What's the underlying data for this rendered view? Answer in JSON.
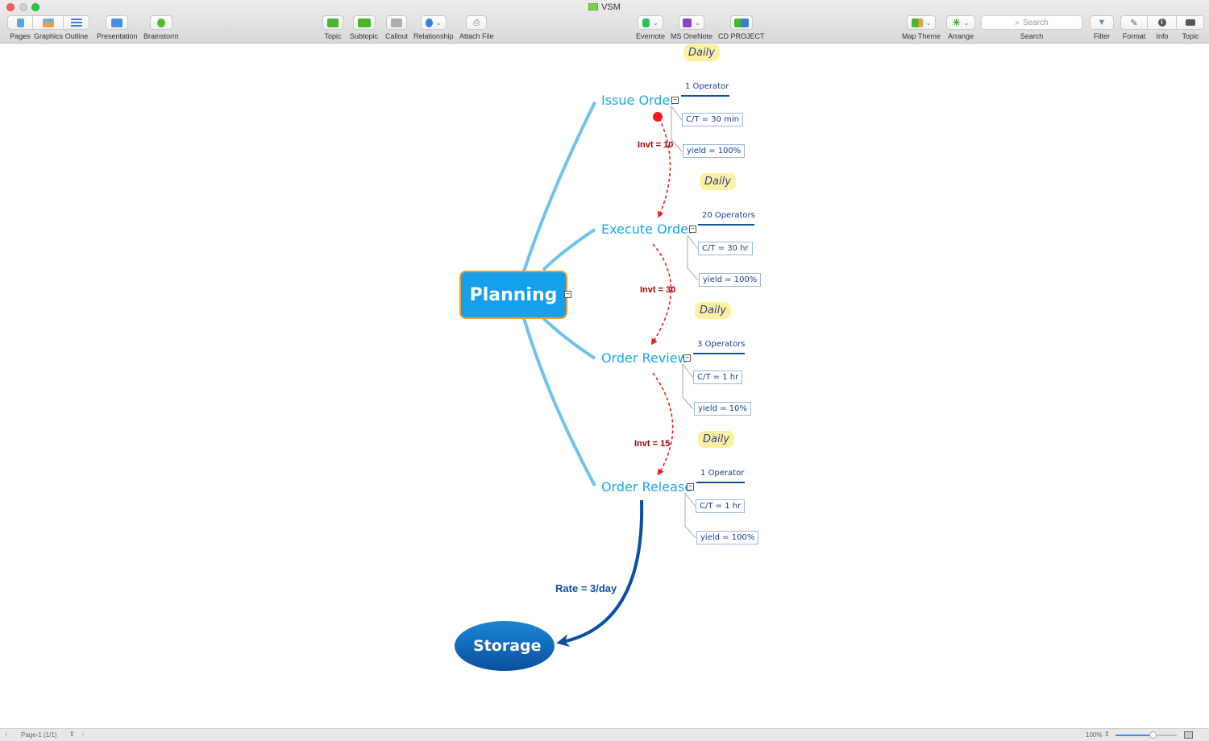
{
  "window": {
    "title": "VSM"
  },
  "toolbar": {
    "left": [
      {
        "id": "pages",
        "label": "Pages",
        "icon": "pages-icon"
      },
      {
        "id": "graphics",
        "label": "Graphics",
        "icon": "graphics-icon"
      },
      {
        "id": "outline",
        "label": "Outline",
        "icon": "outline-icon"
      },
      {
        "id": "presentation",
        "label": "Presentation",
        "icon": "presentation-icon"
      },
      {
        "id": "brainstorm",
        "label": "Brainstorm",
        "icon": "brainstorm-icon"
      }
    ],
    "center": [
      {
        "id": "topic",
        "label": "Topic",
        "icon": "add-topic-icon"
      },
      {
        "id": "subtopic",
        "label": "Subtopic",
        "icon": "add-subtopic-icon"
      },
      {
        "id": "callout",
        "label": "Callout",
        "icon": "add-callout-icon"
      },
      {
        "id": "relationship",
        "label": "Relationship",
        "icon": "relationship-icon"
      },
      {
        "id": "attach",
        "label": "Attach File",
        "icon": "paperclip-icon"
      }
    ],
    "integrations": [
      {
        "id": "evernote",
        "label": "Evernote",
        "icon": "evernote-icon"
      },
      {
        "id": "onenote",
        "label": "MS OneNote",
        "icon": "onenote-icon"
      },
      {
        "id": "cdproject",
        "label": "CD PROJECT",
        "icon": "cd-project-icon"
      }
    ],
    "right": [
      {
        "id": "maptheme",
        "label": "Map Theme",
        "icon": "map-theme-icon"
      },
      {
        "id": "arrange",
        "label": "Arrange",
        "icon": "arrange-icon"
      },
      {
        "id": "search",
        "label": "Search",
        "placeholder": "Search"
      },
      {
        "id": "filter",
        "label": "Filter",
        "icon": "filter-icon"
      },
      {
        "id": "format",
        "label": "Format",
        "icon": "format-icon"
      },
      {
        "id": "info",
        "label": "Info",
        "icon": "info-icon"
      },
      {
        "id": "topicpanel",
        "label": "Topic",
        "icon": "topic-panel-icon"
      }
    ]
  },
  "map": {
    "central": "Planning",
    "storage": "Storage",
    "rate_label": "Rate = 3/day",
    "colors": {
      "central": "#16a0ec",
      "central_border": "#f29b2a",
      "branch": "#6ec2f0",
      "topic_text": "#1aa6e8",
      "storage": "#0a5fb4",
      "invt": "#a00000",
      "arrow": "#f21b1b",
      "label_text": "#1a3d8f",
      "daily_bg": "#fdf1a0"
    },
    "processes": [
      {
        "name": "Issue Order",
        "operators": "1 Operator",
        "ct": "C/T = 30 min",
        "yield": "yield = 100%",
        "schedule": "Daily"
      },
      {
        "name": "Execute Order",
        "operators": "20 Operators",
        "ct": "C/T = 30 hr",
        "yield": "yield = 100%",
        "schedule": "Daily"
      },
      {
        "name": "Order Review",
        "operators": "3 Operators",
        "ct": "C/T = 1 hr",
        "yield": "yield = 10%",
        "schedule": "Daily"
      },
      {
        "name": "Order Release",
        "operators": "1 Operator",
        "ct": "C/T = 1 hr",
        "yield": "yield = 100%",
        "schedule": "Daily"
      }
    ],
    "inventories": [
      "Invt = 10",
      "Invt = 30",
      "Invt = 15"
    ]
  },
  "status": {
    "page": "Page-1 (1/1)",
    "zoom": "100%",
    "zoom_fraction": 0.6
  }
}
